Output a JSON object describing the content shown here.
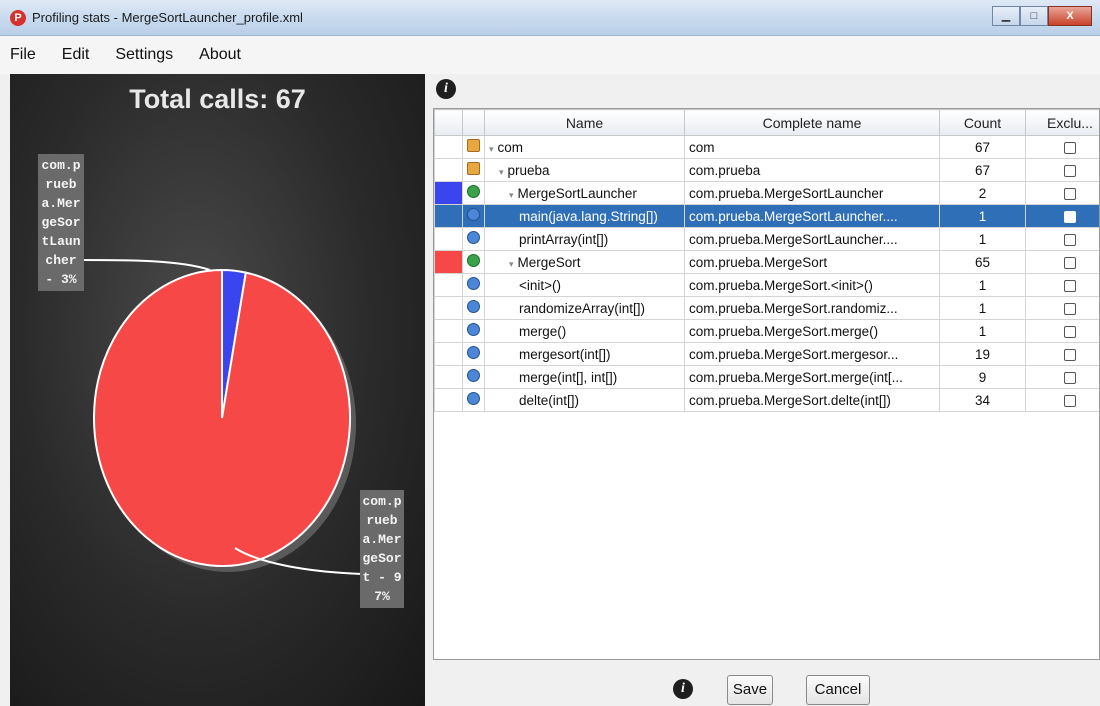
{
  "window": {
    "title": "Profiling stats - MergeSortLauncher_profile.xml",
    "app_icon": "P",
    "min": "▁",
    "max": "□",
    "close": "X"
  },
  "menu": [
    "File",
    "Edit",
    "Settings",
    "About"
  ],
  "chart": {
    "total_calls": "Total calls: 67",
    "chart_data": {
      "type": "pie",
      "title": "Total calls: 67",
      "slices": [
        {
          "label": "com.prueba.MergeSortLauncher - 3%",
          "value": 2,
          "percent": 3,
          "color": "#3a45f0"
        },
        {
          "label": "com.prueba.MergeSort - 97%",
          "value": 65,
          "percent": 97,
          "color": "#f74848"
        }
      ]
    }
  },
  "info_icon": "i",
  "table": {
    "columns": [
      "",
      "",
      "Name",
      "Complete name",
      "Count",
      "Exclu..."
    ],
    "rows": [
      {
        "swatch": "",
        "icon": "pkg",
        "twist": "▾",
        "indent": 0,
        "name": "com",
        "complete": "com",
        "count": "67",
        "selected": false
      },
      {
        "swatch": "",
        "icon": "pkg",
        "twist": "▾",
        "indent": 1,
        "name": "prueba",
        "complete": "com.prueba",
        "count": "67",
        "selected": false
      },
      {
        "swatch": "#3a45f0",
        "icon": "cls",
        "twist": "▾",
        "indent": 2,
        "name": "MergeSortLauncher",
        "complete": "com.prueba.MergeSortLauncher",
        "count": "2",
        "selected": false
      },
      {
        "swatch": "",
        "icon": "meth",
        "twist": "",
        "indent": 3,
        "name": "main(java.lang.String[])",
        "complete": "com.prueba.MergeSortLauncher....",
        "count": "1",
        "selected": true
      },
      {
        "swatch": "",
        "icon": "meth",
        "twist": "",
        "indent": 3,
        "name": "printArray(int[])",
        "complete": "com.prueba.MergeSortLauncher....",
        "count": "1",
        "selected": false
      },
      {
        "swatch": "#f74848",
        "icon": "cls",
        "twist": "▾",
        "indent": 2,
        "name": "MergeSort",
        "complete": "com.prueba.MergeSort",
        "count": "65",
        "selected": false
      },
      {
        "swatch": "",
        "icon": "meth",
        "twist": "",
        "indent": 3,
        "name": "<init>()",
        "complete": "com.prueba.MergeSort.<init>()",
        "count": "1",
        "selected": false
      },
      {
        "swatch": "",
        "icon": "meth",
        "twist": "",
        "indent": 3,
        "name": "randomizeArray(int[])",
        "complete": "com.prueba.MergeSort.randomiz...",
        "count": "1",
        "selected": false
      },
      {
        "swatch": "",
        "icon": "meth",
        "twist": "",
        "indent": 3,
        "name": "merge()",
        "complete": "com.prueba.MergeSort.merge()",
        "count": "1",
        "selected": false
      },
      {
        "swatch": "",
        "icon": "meth",
        "twist": "",
        "indent": 3,
        "name": "mergesort(int[])",
        "complete": "com.prueba.MergeSort.mergesor...",
        "count": "19",
        "selected": false
      },
      {
        "swatch": "",
        "icon": "meth",
        "twist": "",
        "indent": 3,
        "name": "merge(int[], int[])",
        "complete": "com.prueba.MergeSort.merge(int[...",
        "count": "9",
        "selected": false
      },
      {
        "swatch": "",
        "icon": "meth",
        "twist": "",
        "indent": 3,
        "name": "delte(int[])",
        "complete": "com.prueba.MergeSort.delte(int[])",
        "count": "34",
        "selected": false
      }
    ]
  },
  "buttons": {
    "save": "Save",
    "cancel": "Cancel"
  }
}
